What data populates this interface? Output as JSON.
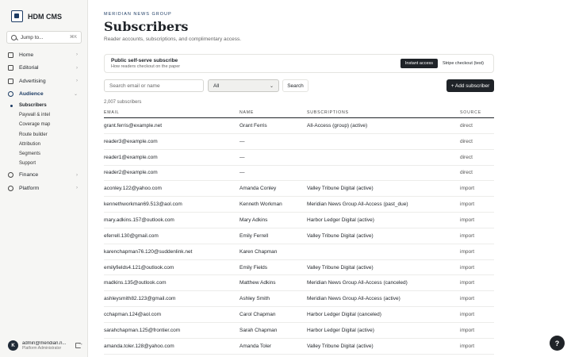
{
  "brand": {
    "name": "HDM CMS"
  },
  "jump": {
    "label": "Jump to...",
    "shortcut": "⌘K"
  },
  "nav": {
    "home": "Home",
    "editorial": "Editorial",
    "advertising": "Advertising",
    "audience": "Audience",
    "audience_sub": [
      "Subscribers",
      "Paywall & intel",
      "Coverage map",
      "Route builder",
      "Attribution",
      "Segments",
      "Support"
    ],
    "finance": "Finance",
    "platform": "Platform"
  },
  "user": {
    "initial": "K",
    "name": "admin@meridian.n...",
    "role": "Platform Administrator"
  },
  "page": {
    "eyebrow": "Meridian News Group",
    "title": "Subscribers",
    "subtitle": "Reader accounts, subscriptions, and complimentary access."
  },
  "checkout": {
    "title": "Public self-serve subscribe",
    "desc": "How readers checkout on the paper",
    "options": [
      "Instant access",
      "Stripe checkout (test)"
    ],
    "selected": "Instant access"
  },
  "filters": {
    "search_placeholder": "Search email or name",
    "status_value": "All",
    "search_button": "Search",
    "add_button": "+ Add subscriber"
  },
  "count": "2,007 subscribers",
  "table": {
    "columns": [
      "Email",
      "Name",
      "Subscriptions",
      "Source"
    ],
    "rows": [
      [
        "grant.ferris@example.net",
        "Grant Ferris",
        "All-Access (group) (active)",
        "direct"
      ],
      [
        "reader3@example.com",
        "—",
        "",
        "direct"
      ],
      [
        "reader1@example.com",
        "—",
        "",
        "direct"
      ],
      [
        "reader2@example.com",
        "—",
        "",
        "direct"
      ],
      [
        "aconley.122@yahoo.com",
        "Amanda Conley",
        "Valley Tribune Digital (active)",
        "import"
      ],
      [
        "kennethworkman69.513@aol.com",
        "Kenneth Workman",
        "Meridian News Group All-Access (past_due)",
        "import"
      ],
      [
        "mary.adkins.157@outlook.com",
        "Mary Adkins",
        "Harbor Ledger Digital (active)",
        "import"
      ],
      [
        "eferrell.130@gmail.com",
        "Emily Ferrell",
        "Valley Tribune Digital (active)",
        "import"
      ],
      [
        "karenchapman76.120@suddenlink.net",
        "Karen Chapman",
        "",
        "import"
      ],
      [
        "emilyfields4.121@outlook.com",
        "Emily Fields",
        "Valley Tribune Digital (active)",
        "import"
      ],
      [
        "madkins.135@outlook.com",
        "Matthew Adkins",
        "Meridian News Group All-Access (canceled)",
        "import"
      ],
      [
        "ashleysmith82.123@gmail.com",
        "Ashley Smith",
        "Meridian News Group All-Access (active)",
        "import"
      ],
      [
        "cchapman.124@aol.com",
        "Carol Chapman",
        "Harbor Ledger Digital (canceled)",
        "import"
      ],
      [
        "sarahchapman.125@frontier.com",
        "Sarah Chapman",
        "Harbor Ledger Digital (active)",
        "import"
      ],
      [
        "amanda.toler.128@yahoo.com",
        "Amanda Toler",
        "Valley Tribune Digital (active)",
        "import"
      ]
    ]
  },
  "help": {
    "label": "?"
  }
}
